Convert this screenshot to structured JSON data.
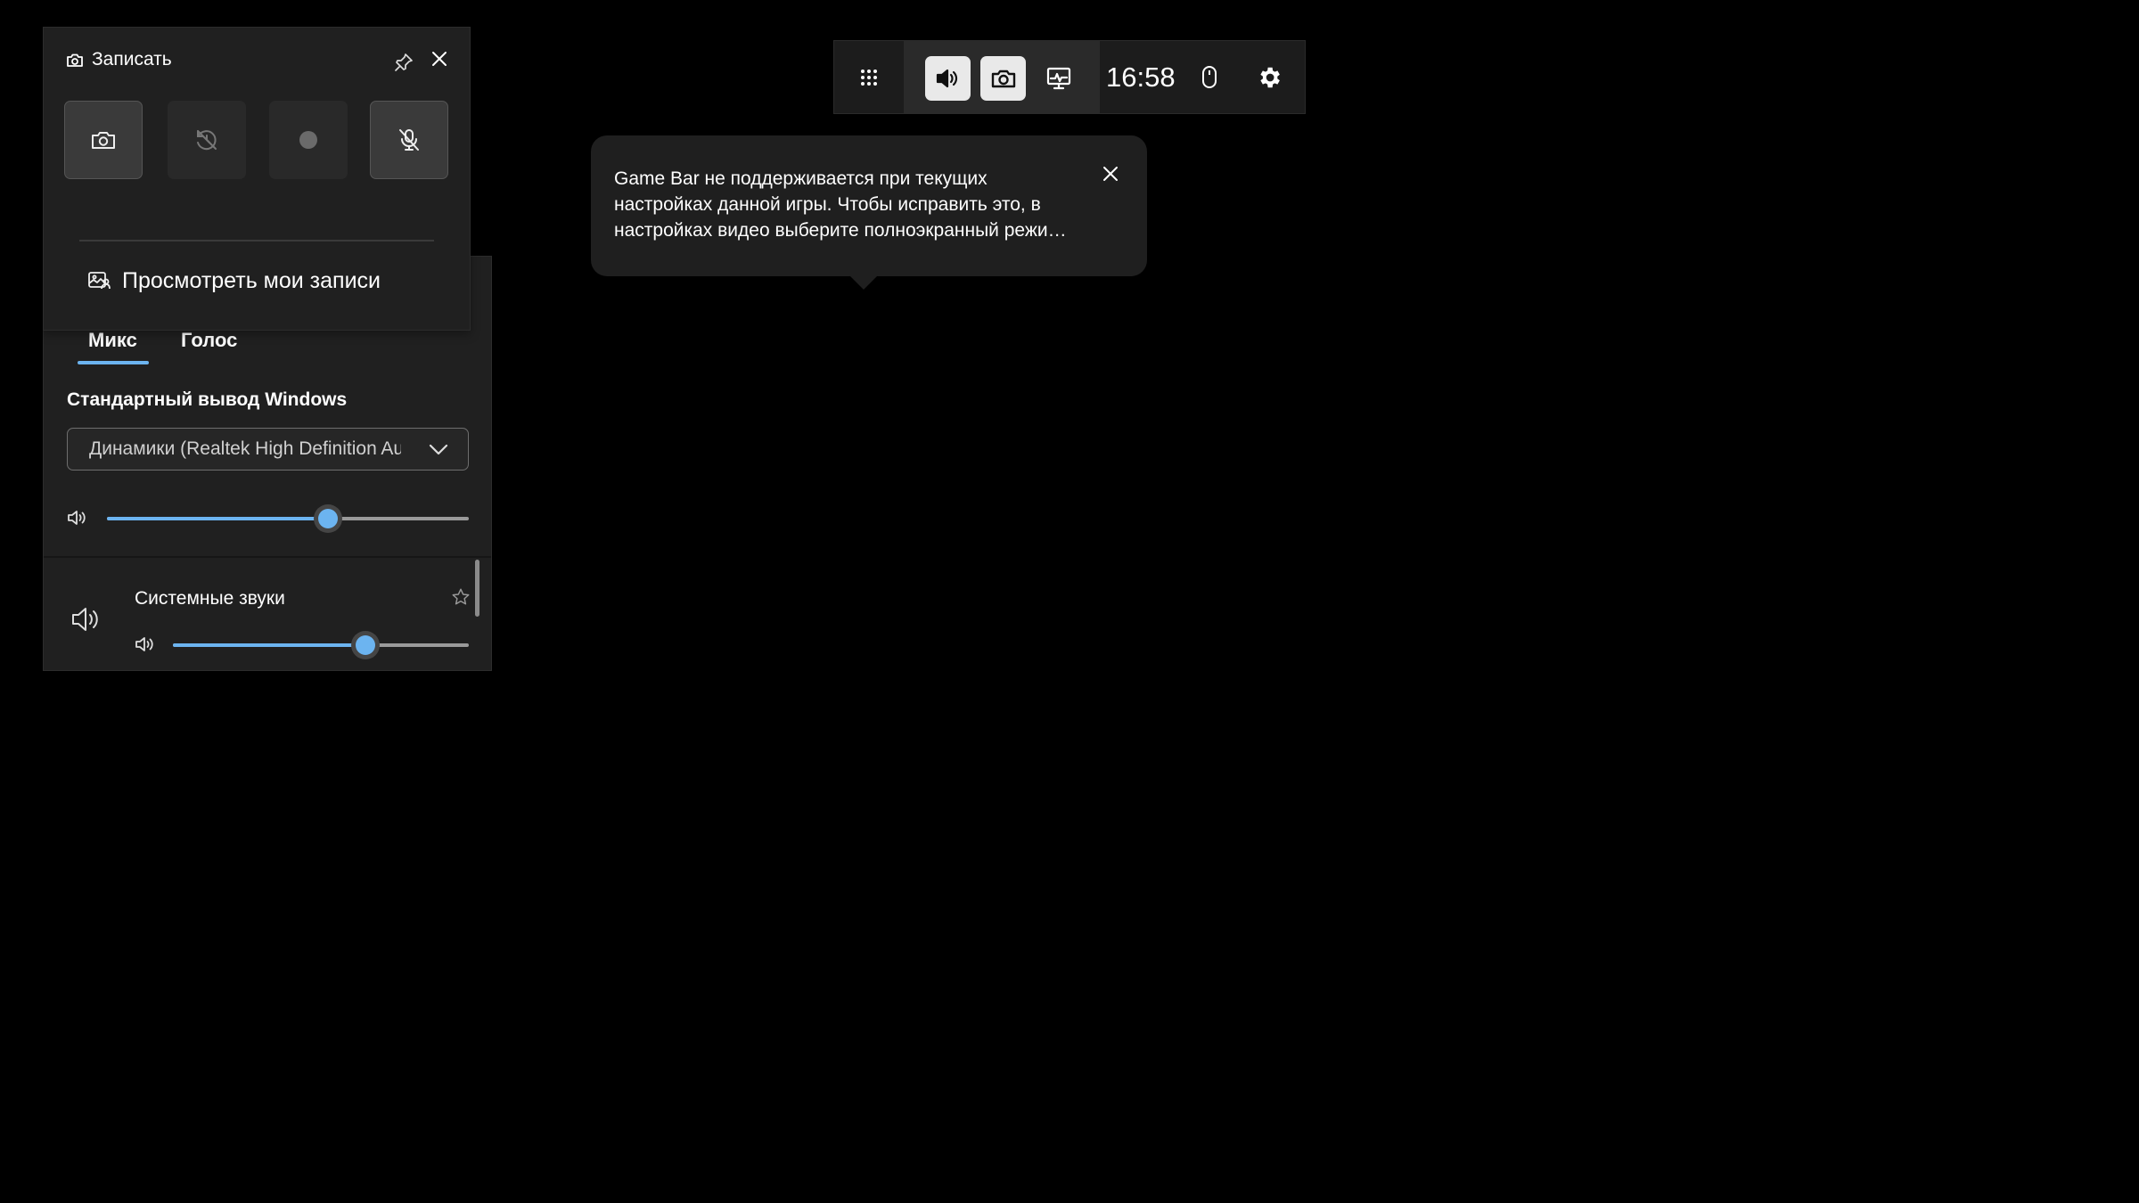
{
  "topbar": {
    "clock": "16:58",
    "icons": [
      "widget-menu-icon",
      "speaker-icon",
      "camera-icon",
      "performance-icon",
      "mouse-icon",
      "gear-icon"
    ],
    "active_widgets": [
      "audio",
      "capture"
    ]
  },
  "notification": {
    "text": "Game Bar не поддерживается при текущих настройках данной игры. Чтобы исправить это, в настройках видео выберите полноэкранный режи…"
  },
  "capture": {
    "title": "Записать",
    "buttons": [
      {
        "name": "screenshot",
        "icon": "camera-icon",
        "state": "enabled"
      },
      {
        "name": "record-last",
        "icon": "record-last-icon",
        "state": "disabled"
      },
      {
        "name": "start-recording",
        "icon": "record-dot-icon",
        "state": "disabled"
      },
      {
        "name": "mic-muted",
        "icon": "mic-off-icon",
        "state": "enabled"
      }
    ],
    "gallery_link": "Просмотреть мои записи"
  },
  "audio": {
    "tabs": [
      {
        "label": "Микс",
        "selected": true
      },
      {
        "label": "Голос",
        "selected": false
      }
    ],
    "section_title": "Стандартный вывод Windows",
    "output_device": "Динамики (Realtek High Definition Audio)",
    "master_volume_percent": 61,
    "apps": [
      {
        "name": "Системные звуки",
        "volume_percent": 65
      }
    ]
  },
  "colors": {
    "accent": "#6cb4f0",
    "panel_bg": "#202020",
    "topbar_bg": "#1c1c1c",
    "active_button_bg": "#e9e9e9"
  }
}
